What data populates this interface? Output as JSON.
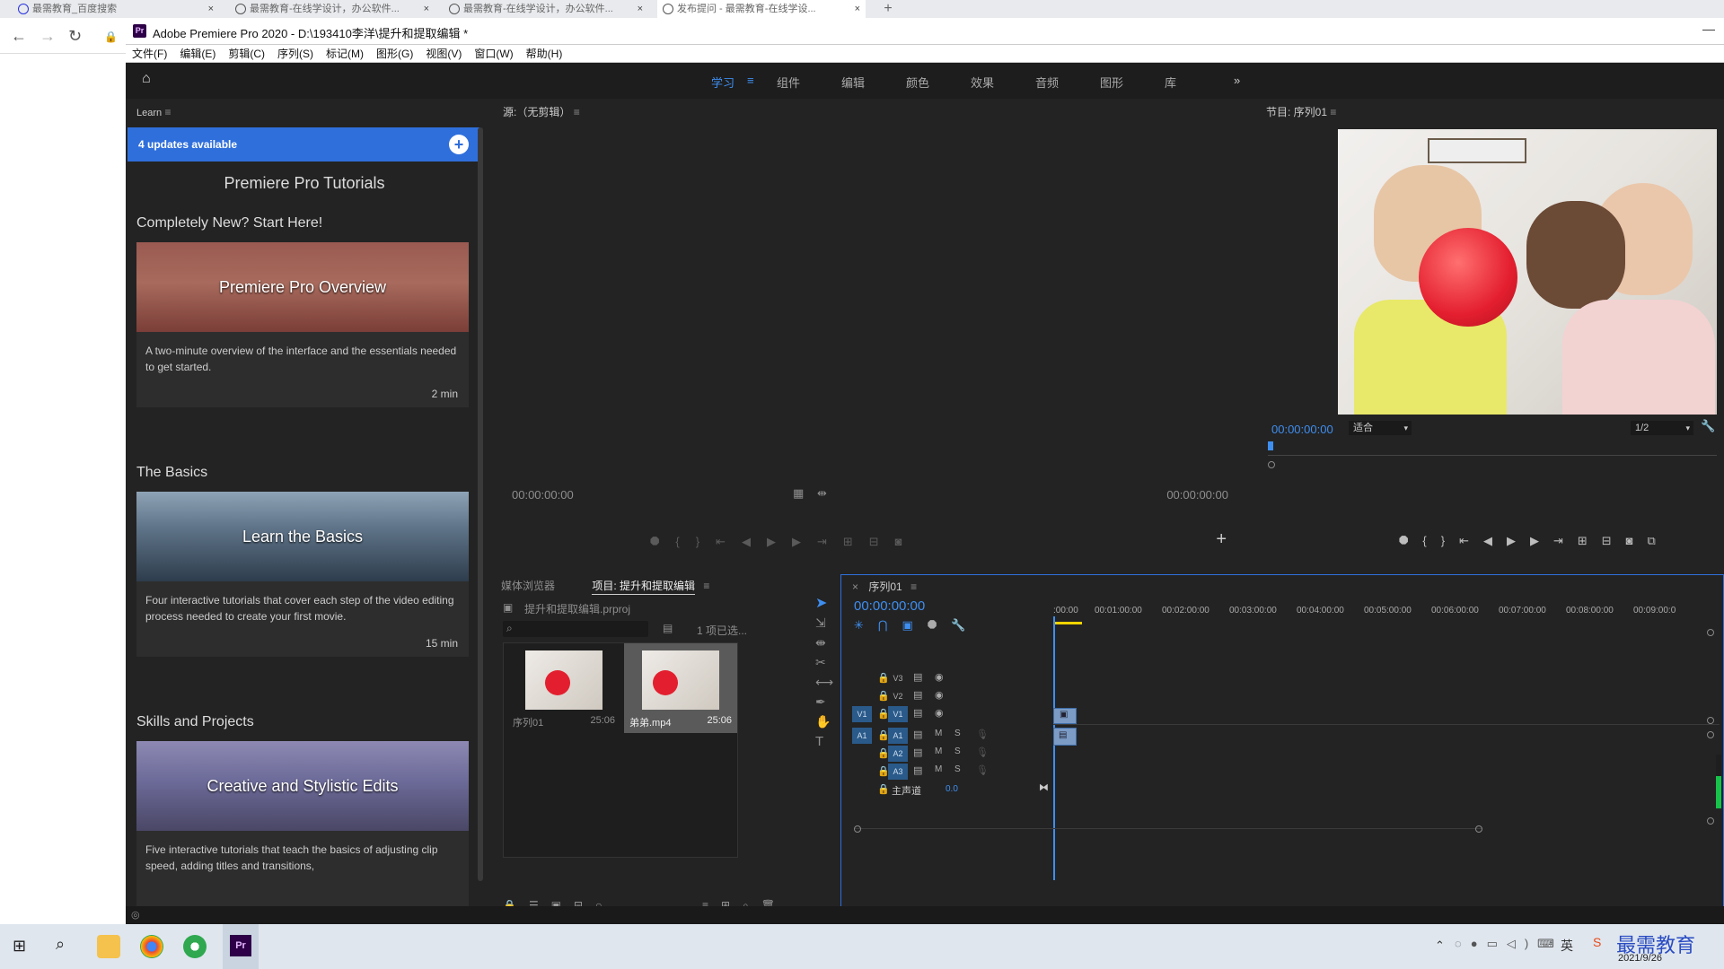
{
  "browser": {
    "tabs": [
      {
        "title": "最需教育_百度搜索"
      },
      {
        "title": "最需教育-在线学设计，办公软件..."
      },
      {
        "title": "最需教育-在线学设计，办公软件..."
      },
      {
        "title": "发布提问 - 最需教育-在线学设..."
      }
    ],
    "new_tab": "+"
  },
  "app": {
    "title": "Adobe Premiere Pro 2020 - D:\\193410李洋\\提升和提取编辑 *",
    "logo_text": "Pr",
    "menu": [
      "文件(F)",
      "编辑(E)",
      "剪辑(C)",
      "序列(S)",
      "标记(M)",
      "图形(G)",
      "视图(V)",
      "窗口(W)",
      "帮助(H)"
    ],
    "workspaces": [
      "学习",
      "组件",
      "编辑",
      "颜色",
      "效果",
      "音频",
      "图形",
      "库"
    ],
    "workspace_active": "学习",
    "workspace_overflow": "»"
  },
  "learn": {
    "panel_title": "Learn",
    "updates": "4 updates available",
    "title": "Premiere Pro Tutorials",
    "sections": [
      {
        "heading": "Completely New? Start Here!",
        "card_title": "Premiere Pro Overview",
        "description": "A two-minute overview of the interface and the essentials needed to get started.",
        "duration": "2 min"
      },
      {
        "heading": "The Basics",
        "card_title": "Learn the Basics",
        "description": "Four interactive tutorials that cover each step of the video editing process needed to create your first movie.",
        "duration": "15 min"
      },
      {
        "heading": "Skills and Projects",
        "card_title": "Creative and Stylistic Edits",
        "description": "Five interactive tutorials that teach the basics of adjusting clip speed, adding titles and transitions,",
        "duration": ""
      }
    ]
  },
  "source": {
    "title": "源:（无剪辑）",
    "timecode_left": "00:00:00:00",
    "timecode_right": "00:00:00:00"
  },
  "program": {
    "title": "节目: 序列01",
    "timecode": "00:00:00:00",
    "fit": "适合",
    "resolution": "1/2"
  },
  "project": {
    "tab_media": "媒体浏览器",
    "tab_project": "项目: 提升和提取编辑",
    "file": "提升和提取编辑.prproj",
    "selected": "1 项已选...",
    "items": [
      {
        "name": "序列01",
        "duration": "25:06"
      },
      {
        "name": "弟弟.mp4",
        "duration": "25:06"
      }
    ]
  },
  "timeline": {
    "tab": "序列01",
    "timecode": "00:00:00:00",
    "ruler": [
      ":00:00",
      "00:01:00:00",
      "00:02:00:00",
      "00:03:00:00",
      "00:04:00:00",
      "00:05:00:00",
      "00:06:00:00",
      "00:07:00:00",
      "00:08:00:00",
      "00:09:00:0"
    ],
    "video_tracks": [
      "V3",
      "V2",
      "V1"
    ],
    "audio_tracks": [
      "A1",
      "A2",
      "A3"
    ],
    "master_label": "主声道",
    "master_value": "0.0",
    "m_label": "M",
    "s_label": "S"
  },
  "taskbar": {
    "tray_lang": "英",
    "date": "2021/9/26",
    "watermark": "最需教育"
  },
  "colors": {
    "accent": "#2f6fdc",
    "timecode": "#3e8ef0",
    "panel_bg": "#232323"
  }
}
